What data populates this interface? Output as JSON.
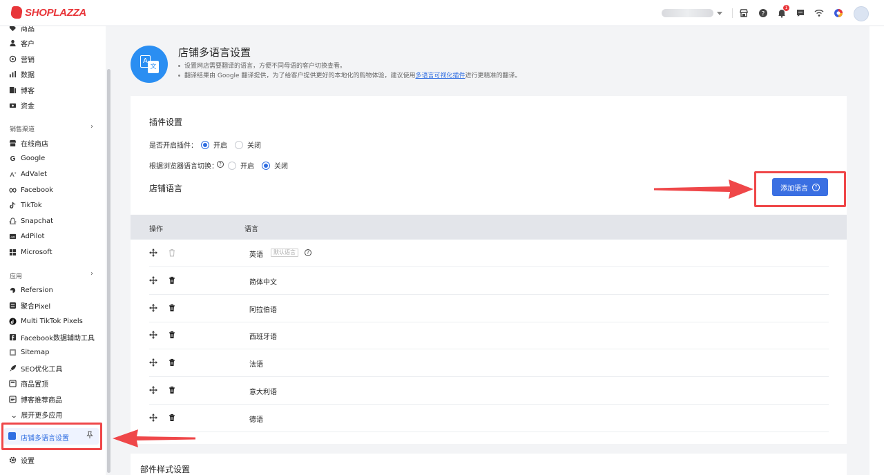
{
  "topbar": {
    "logo_text": "SHOPLAZZA",
    "notification_count": "1",
    "icons": [
      "store-icon",
      "help-icon",
      "bell-icon",
      "chat-icon",
      "wifi-icon",
      "color-wheel-icon"
    ]
  },
  "sidebar": {
    "items_top": [
      {
        "label": "商品",
        "icon": "tag-icon"
      },
      {
        "label": "客户",
        "icon": "user-icon"
      },
      {
        "label": "营销",
        "icon": "target-icon"
      },
      {
        "label": "数据",
        "icon": "bar-chart-icon"
      },
      {
        "label": "博客",
        "icon": "blog-icon"
      },
      {
        "label": "资金",
        "icon": "wallet-icon"
      }
    ],
    "section_sales": "销售渠道",
    "sales_channels": [
      {
        "label": "在线商店",
        "icon": "store-icon"
      },
      {
        "label": "Google",
        "icon": "google-icon"
      },
      {
        "label": "AdValet",
        "icon": "advalet-icon"
      },
      {
        "label": "Facebook",
        "icon": "meta-icon"
      },
      {
        "label": "TikTok",
        "icon": "tiktok-icon"
      },
      {
        "label": "Snapchat",
        "icon": "snapchat-icon"
      },
      {
        "label": "AdPilot",
        "icon": "adpilot-icon"
      },
      {
        "label": "Microsoft",
        "icon": "microsoft-icon"
      }
    ],
    "section_apps": "应用",
    "apps": [
      {
        "label": "Refersion",
        "icon": "refersion-icon"
      },
      {
        "label": "聚合Pixel",
        "icon": "pixel-icon"
      },
      {
        "label": "Multi TikTok Pixels",
        "icon": "tiktok-pixel-icon"
      },
      {
        "label": "Facebook数据辅助工具",
        "icon": "facebook-icon"
      },
      {
        "label": "Sitemap",
        "icon": "sitemap-icon"
      },
      {
        "label": "SEO优化工具",
        "icon": "rocket-icon"
      },
      {
        "label": "商品置顶",
        "icon": "pin-top-icon"
      },
      {
        "label": "博客推荐商品",
        "icon": "blog-product-icon"
      }
    ],
    "expand_more": "展开更多应用",
    "active_item": "店铺多语言设置",
    "settings": "设置"
  },
  "header": {
    "title": "店铺多语言设置",
    "desc1": "设置网店需要翻译的语言，方便不同母语的客户切换查看。",
    "desc2_prefix": "翻译结果由 Google 翻译提供，为了给客户提供更好的本地化的购物体验，建议使用",
    "desc2_link": "多语言可视化插件",
    "desc2_suffix": "进行更精准的翻译。"
  },
  "plugin_settings": {
    "title": "插件设置",
    "enable_label": "是否开启插件：",
    "enable_on": "开启",
    "enable_off": "关闭",
    "enable_value": "on",
    "browser_label": "根据浏览器语言切换：",
    "browser_on": "开启",
    "browser_off": "关闭",
    "browser_value": "off"
  },
  "languages": {
    "title": "店铺语言",
    "add_button": "添加语言",
    "col_action": "操作",
    "col_language": "语言",
    "default_tag": "默认语言",
    "rows": [
      {
        "name": "英语",
        "default": true
      },
      {
        "name": "简体中文",
        "default": false
      },
      {
        "name": "阿拉伯语",
        "default": false
      },
      {
        "name": "西班牙语",
        "default": false
      },
      {
        "name": "法语",
        "default": false
      },
      {
        "name": "意大利语",
        "default": false
      },
      {
        "name": "德语",
        "default": false
      }
    ]
  },
  "next_section_title": "部件样式设置",
  "colors": {
    "primary": "#3a6fe2",
    "highlight_red": "#ef4749",
    "brand": "#e8363a"
  }
}
